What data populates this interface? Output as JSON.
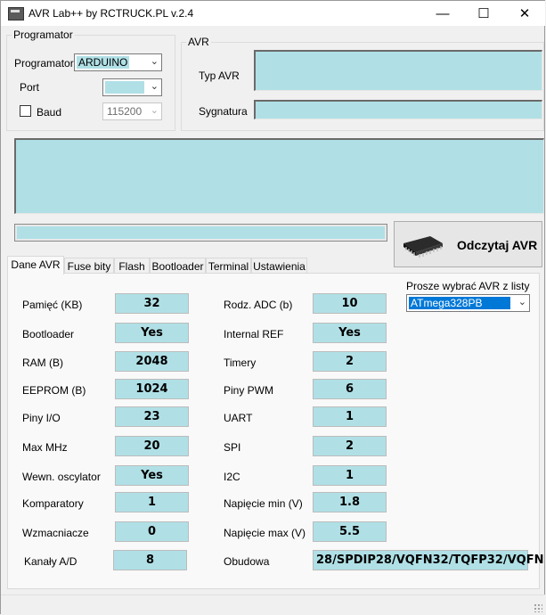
{
  "window": {
    "title": "AVR Lab++ by RCTRUCK.PL v.2.4",
    "minimize": "—",
    "maximize": "☐",
    "close": "✕"
  },
  "programator": {
    "group_title": "Programator",
    "programator_label": "Programator",
    "programator_value": "ARDUINO",
    "port_label": "Port",
    "port_value": "",
    "baud_label": "Baud",
    "baud_checked": false,
    "baud_value": "115200"
  },
  "avr": {
    "group_title": "AVR",
    "typ_label": "Typ AVR",
    "typ_value": "",
    "sygnatura_label": "Sygnatura",
    "sygnatura_value": ""
  },
  "read_button": {
    "label": "Odczytaj AVR",
    "icon": "chip-icon"
  },
  "tabs": [
    "Dane AVR",
    "Fuse bity",
    "Flash",
    "Bootloader",
    "Terminal",
    "Ustawienia"
  ],
  "active_tab": "Dane AVR",
  "select_avr": {
    "label": "Prosze wybrać AVR z listy",
    "value": "ATmega328PB"
  },
  "left_rows": [
    {
      "label": "Pamięć (KB)",
      "value": "32"
    },
    {
      "label": "Bootloader",
      "value": "Yes"
    },
    {
      "label": "RAM (B)",
      "value": "2048"
    },
    {
      "label": "EEPROM (B)",
      "value": "1024"
    },
    {
      "label": "Piny I/O",
      "value": "23"
    },
    {
      "label": "Max MHz",
      "value": "20"
    },
    {
      "label": "Wewn. oscylator",
      "value": "Yes"
    },
    {
      "label": "Komparatory",
      "value": "1"
    },
    {
      "label": "Wzmacniacze",
      "value": "0"
    },
    {
      "label": "Kanały A/D",
      "value": "8"
    }
  ],
  "right_rows": [
    {
      "label": "Rodz. ADC (b)",
      "value": "10"
    },
    {
      "label": "Internal REF",
      "value": "Yes"
    },
    {
      "label": "Timery",
      "value": "2"
    },
    {
      "label": "Piny PWM",
      "value": "6"
    },
    {
      "label": "UART",
      "value": "1"
    },
    {
      "label": "SPI",
      "value": "2"
    },
    {
      "label": "I2C",
      "value": "1"
    },
    {
      "label": "Napięcie min (V)",
      "value": "1.8"
    },
    {
      "label": "Napięcie max (V)",
      "value": "5.5"
    },
    {
      "label": "Obudowa",
      "value": "28/SPDIP28/VQFN32/TQFP32/VQFN"
    }
  ],
  "colors": {
    "field_bg": "#b0e0e6",
    "window_bg": "#f0f0f0"
  }
}
